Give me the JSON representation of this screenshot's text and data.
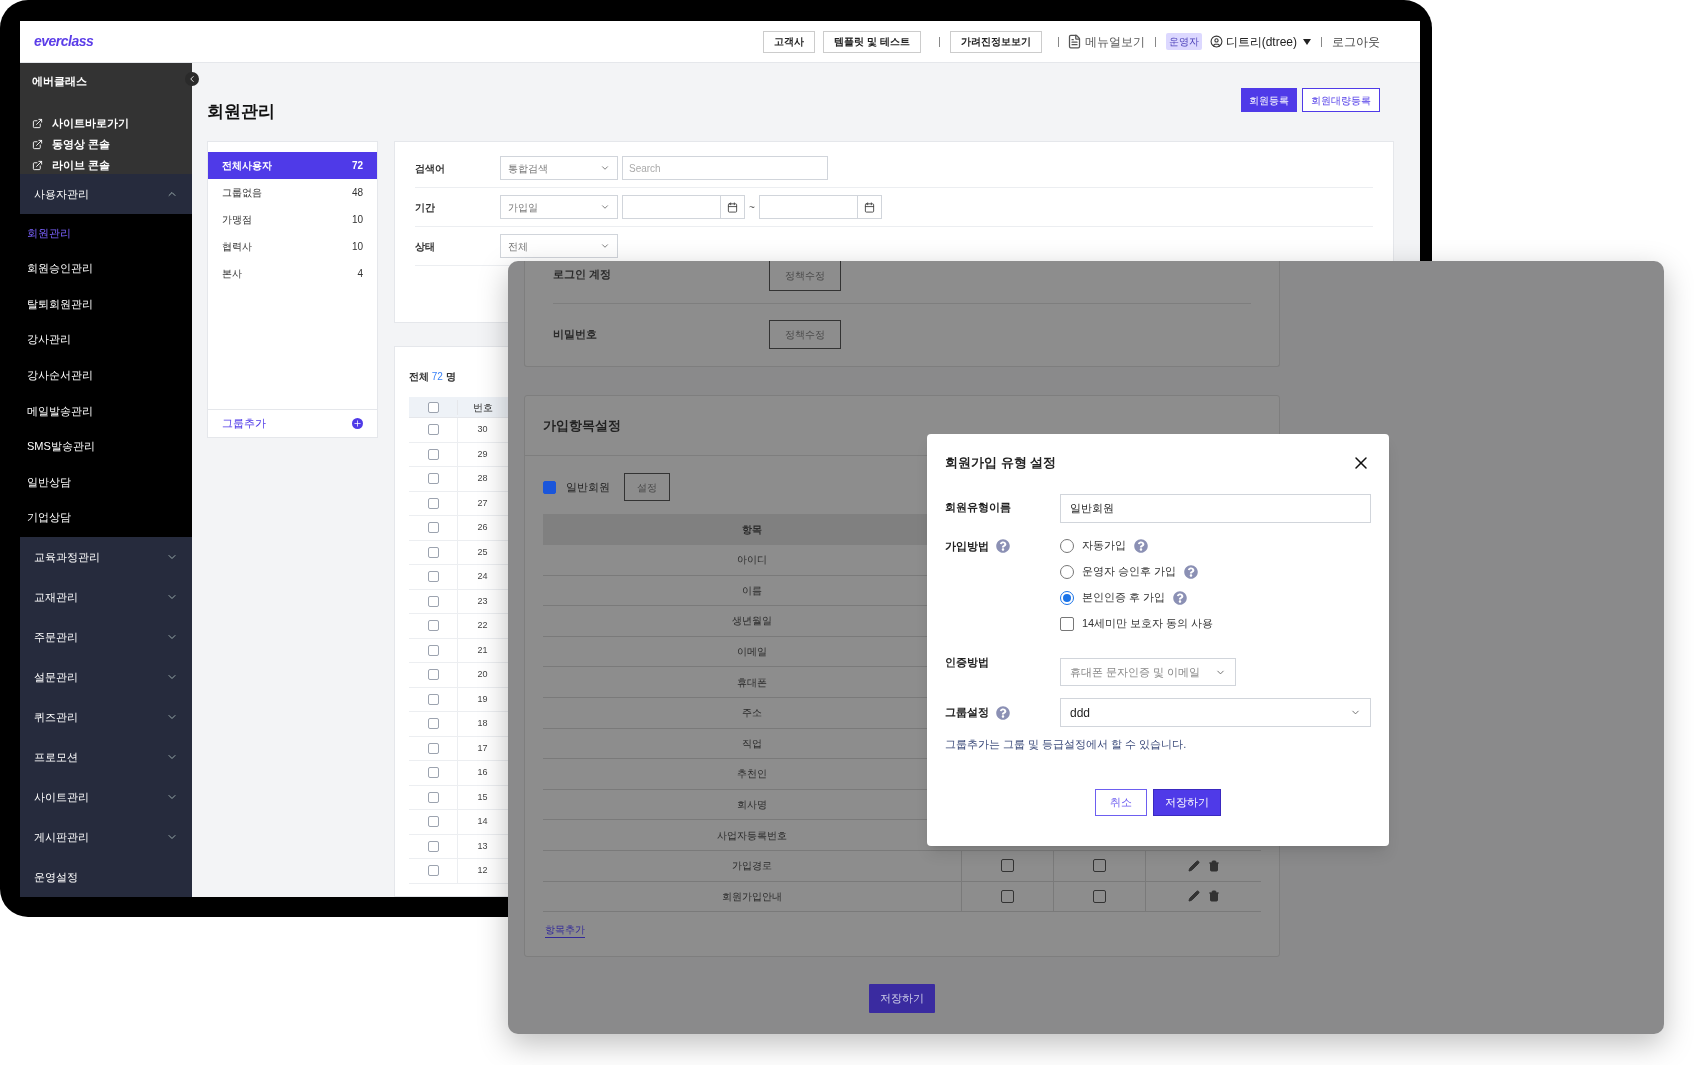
{
  "header": {
    "logo": "everclass",
    "buttons": [
      "고객사",
      "템플릿 및 테스트",
      "가려진정보보기"
    ],
    "manual": "메뉴얼보기",
    "role_badge": "운영자",
    "user": "디트리(dtree)",
    "logout": "로그아웃"
  },
  "sidebar": {
    "brand": "에버클래스",
    "links": [
      "사이트바로가기",
      "동영상 콘솔",
      "라이브 콘솔"
    ],
    "sections": [
      {
        "label": "사용자관리",
        "expanded": true,
        "children": [
          {
            "label": "회원관리",
            "selected": true
          },
          {
            "label": "회원승인관리",
            "selected": false
          },
          {
            "label": "탈퇴회원관리",
            "selected": false
          },
          {
            "label": "강사관리",
            "selected": false
          },
          {
            "label": "강사순서관리",
            "selected": false
          },
          {
            "label": "메일발송관리",
            "selected": false
          },
          {
            "label": "SMS발송관리",
            "selected": false
          },
          {
            "label": "일반상담",
            "selected": false
          },
          {
            "label": "기업상담",
            "selected": false
          }
        ]
      },
      {
        "label": "교육과정관리",
        "expanded": false
      },
      {
        "label": "교재관리",
        "expanded": false
      },
      {
        "label": "주문관리",
        "expanded": false
      },
      {
        "label": "설문관리",
        "expanded": false
      },
      {
        "label": "퀴즈관리",
        "expanded": false
      },
      {
        "label": "프로모션",
        "expanded": false
      },
      {
        "label": "사이트관리",
        "expanded": false
      },
      {
        "label": "게시판관리",
        "expanded": false
      },
      {
        "label": "운영설정"
      }
    ]
  },
  "page": {
    "title": "회원관리",
    "buttons": [
      {
        "label": "회원등록",
        "kind": "primary"
      },
      {
        "label": "회원대량등록",
        "kind": "outline"
      }
    ]
  },
  "groups": {
    "items": [
      {
        "label": "전체사용자",
        "count": "72",
        "selected": true
      },
      {
        "label": "그룹없음",
        "count": "48",
        "selected": false
      },
      {
        "label": "가맹점",
        "count": "10",
        "selected": false
      },
      {
        "label": "협력사",
        "count": "10",
        "selected": false
      },
      {
        "label": "본사",
        "count": "4",
        "selected": false
      }
    ],
    "add": "그룹추가"
  },
  "search": {
    "rows": [
      {
        "label": "검색어",
        "kind": "search",
        "select": "통합검색",
        "placeholder": "Search"
      },
      {
        "label": "기간",
        "kind": "date",
        "select": "가입일",
        "separator": "~"
      },
      {
        "label": "상태",
        "kind": "select",
        "select": "전체"
      }
    ]
  },
  "members": {
    "total_prefix": "전체",
    "total": "72",
    "total_suffix": "명",
    "column": "번호",
    "header_checked": false,
    "rows": [
      {
        "number": "30",
        "checked": false
      },
      {
        "number": "29",
        "checked": false
      },
      {
        "number": "28",
        "checked": false
      },
      {
        "number": "27",
        "checked": false
      },
      {
        "number": "26",
        "checked": false
      },
      {
        "number": "25",
        "checked": false
      },
      {
        "number": "24",
        "checked": false
      },
      {
        "number": "23",
        "checked": false
      },
      {
        "number": "22",
        "checked": false
      },
      {
        "number": "21",
        "checked": false
      },
      {
        "number": "20",
        "checked": false
      },
      {
        "number": "19",
        "checked": false
      },
      {
        "number": "18",
        "checked": false
      },
      {
        "number": "17",
        "checked": false
      },
      {
        "number": "16",
        "checked": false
      },
      {
        "number": "15",
        "checked": false
      },
      {
        "number": "14",
        "checked": false
      },
      {
        "number": "13",
        "checked": false
      },
      {
        "number": "12",
        "checked": false
      }
    ]
  },
  "settings_window": {
    "account_rows": [
      {
        "label": "로그인 계정",
        "button": "정책수정"
      },
      {
        "label": "비밀번호",
        "button": "정책수정"
      }
    ],
    "signup_fields": {
      "title": "가입항목설정",
      "member_type": {
        "label": "일반회원",
        "checked": true
      },
      "set_button": "설정",
      "column": "항목",
      "rows": [
        {
          "label": "아이디"
        },
        {
          "label": "이름"
        },
        {
          "label": "생년월일"
        },
        {
          "label": "이메일"
        },
        {
          "label": "휴대폰"
        },
        {
          "label": "주소"
        },
        {
          "label": "직업"
        },
        {
          "label": "추천인"
        },
        {
          "label": "회사명"
        },
        {
          "label": "사업자등록번호"
        },
        {
          "label": "가입경로",
          "column_2": false,
          "column_3": false
        },
        {
          "label": "회원가입안내",
          "column_2": false,
          "column_3": false
        }
      ],
      "add_link": "항목추가"
    },
    "save": "저장하기"
  },
  "modal": {
    "title": "회원가입 유형 설정",
    "name": {
      "label": "회원유형이름",
      "value": "일반회원"
    },
    "method": {
      "label": "가입방법",
      "options": [
        {
          "kind": "radio",
          "label": "자동가입",
          "selected": false
        },
        {
          "kind": "radio",
          "label": "운영자 승인후 가입",
          "selected": false
        },
        {
          "kind": "radio",
          "label": "본인인증 후 가입",
          "selected": true
        },
        {
          "kind": "checkbox",
          "label": "14세미만 보호자 동의 사용",
          "checked": false
        }
      ]
    },
    "auth": {
      "label": "인증방법",
      "value": "휴대폰 문자인증 및 이메일"
    },
    "group": {
      "label": "그룹설정",
      "value": "ddd"
    },
    "note": "그룹추가는 그룹 및 등급설정에서 할 수 있습니다.",
    "buttons": [
      {
        "label": "취소",
        "kind": "outline"
      },
      {
        "label": "저장하기",
        "kind": "primary"
      }
    ]
  }
}
